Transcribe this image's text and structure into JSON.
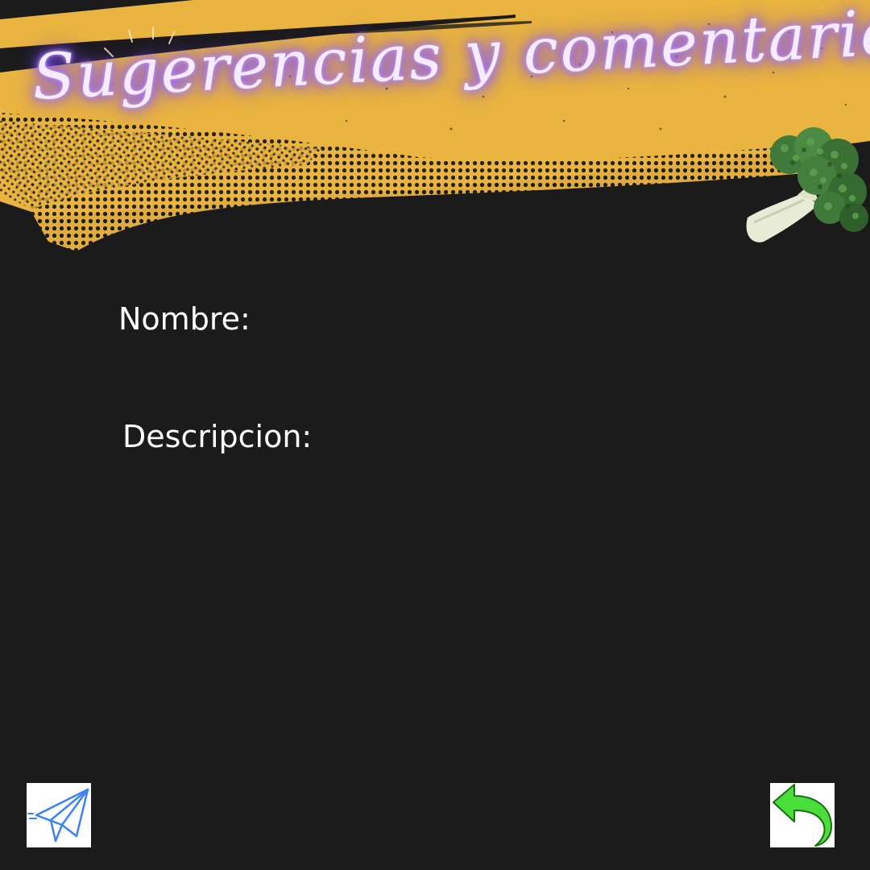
{
  "header": {
    "title": "Sugerencias y comentarios"
  },
  "form": {
    "name_label": "Nombre:",
    "description_label": "Descripcion:"
  },
  "actions": {
    "send_icon": "paper-plane-icon",
    "back_icon": "back-arrow-icon"
  },
  "decorations": {
    "banner_color": "#e9b43f",
    "background_color": "#1c1b1c",
    "title_glow_color": "#a46dff",
    "broccoli_icon": "broccoli-icon"
  }
}
